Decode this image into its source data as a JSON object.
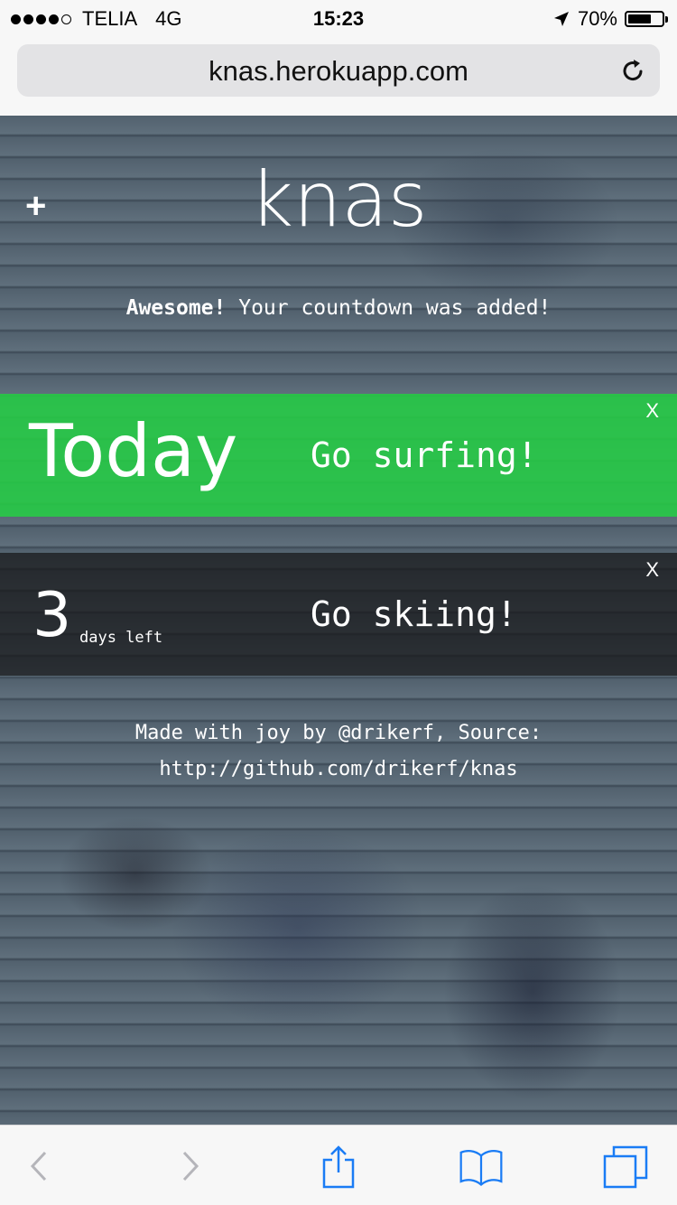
{
  "status_bar": {
    "carrier": "TELIA",
    "network": "4G",
    "time": "15:23",
    "battery": "70%",
    "battery_level": 0.7,
    "signal_bars_filled": 4,
    "signal_bars_total": 5
  },
  "browser": {
    "url": "knas.herokuapp.com",
    "reload_icon": "reload-icon"
  },
  "page": {
    "add_label": "+",
    "title": "knas",
    "flash_strong": "Awesome!",
    "flash_text": " Your countdown was added!",
    "countdowns": [
      {
        "when": "Today",
        "name": "Go surfing!",
        "close": "X",
        "color": "#26cd46"
      },
      {
        "when": "3",
        "unit": "days left",
        "name": "Go skiing!",
        "close": "X"
      }
    ],
    "footer_line1": "Made with joy by @drikerf, Source:",
    "footer_line2": "http://github.com/drikerf/knas"
  },
  "toolbar": {
    "items": [
      "back-icon",
      "forward-icon",
      "share-icon",
      "bookmarks-icon",
      "tabs-icon"
    ],
    "accent": "#1a7cf5"
  }
}
